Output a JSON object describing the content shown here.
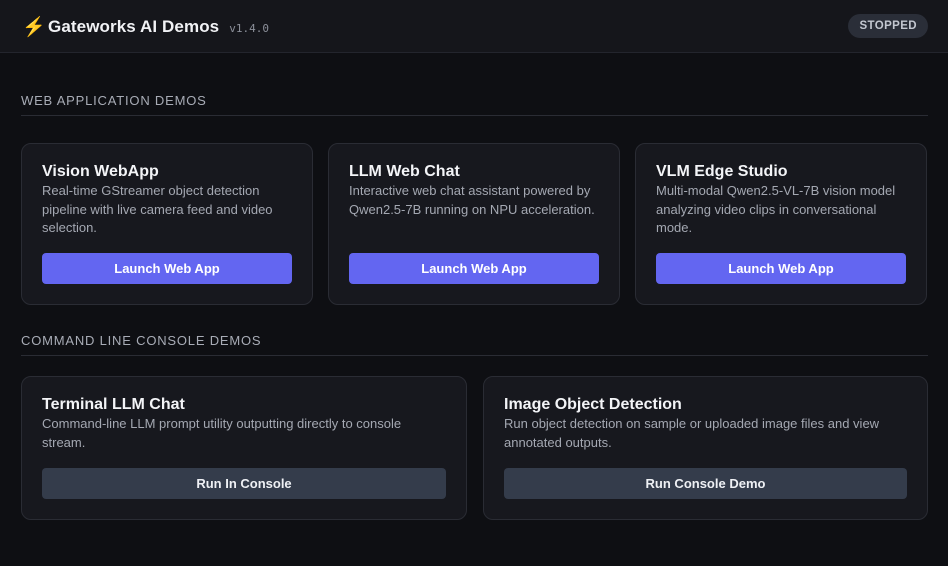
{
  "header": {
    "icon": "lightning-bolt-icon",
    "title": "Gateworks AI Demos",
    "version": "v1.4.0",
    "status": "STOPPED"
  },
  "sections": {
    "web": {
      "heading": "WEB APPLICATION DEMOS",
      "cards": [
        {
          "title": "Vision WebApp",
          "description": "Real-time GStreamer object detection pipeline with live camera feed and video selection.",
          "button": "Launch Web App"
        },
        {
          "title": "LLM Web Chat",
          "description": "Interactive web chat assistant powered by Qwen2.5-7B running on NPU acceleration.",
          "button": "Launch Web App"
        },
        {
          "title": "VLM Edge Studio",
          "description": "Multi-modal Qwen2.5-VL-7B vision model analyzing video clips in conversational mode.",
          "button": "Launch Web App"
        }
      ]
    },
    "cli": {
      "heading": "COMMAND LINE CONSOLE DEMOS",
      "cards": [
        {
          "title": "Terminal LLM Chat",
          "description": "Command-line LLM prompt utility outputting directly to console stream.",
          "button": "Run In Console"
        },
        {
          "title": "Image Object Detection",
          "description": "Run object detection on sample or uploaded image files and view annotated outputs.",
          "button": "Run Console Demo"
        }
      ]
    }
  },
  "colors": {
    "background": "#0e0f13",
    "card": "#17181e",
    "primary_button": "#6366f1",
    "secondary_button": "#343c4b",
    "bolt": "#f5c518"
  }
}
